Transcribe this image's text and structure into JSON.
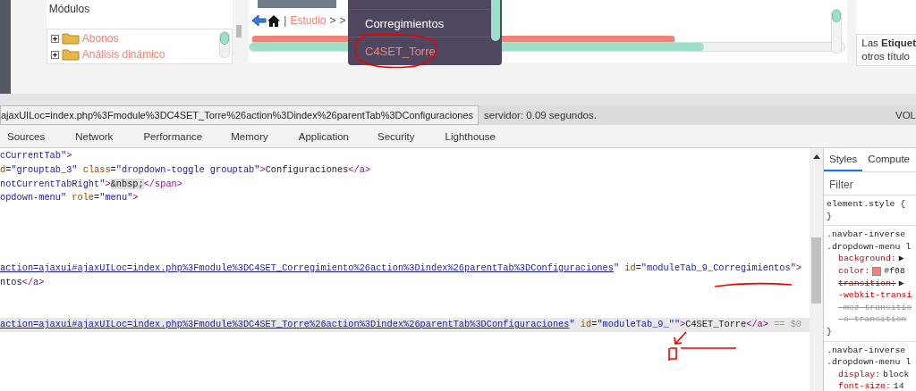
{
  "page": {
    "modules_title": "Módulos",
    "module_tree": [
      {
        "label": "Abonos",
        "expanded": false
      },
      {
        "label": "Análisis dinámico",
        "expanded": false
      }
    ],
    "breadcrumb": {
      "separator": "|",
      "current": "Estudio",
      "arrows": [
        ">",
        ">"
      ]
    },
    "dropdown_menu": [
      {
        "label": "Corregimientos",
        "selected": false
      },
      {
        "label": "C4SET_Torre",
        "selected": true
      }
    ],
    "side_note": [
      "Las **Etiquet**",
      "otros título"
    ]
  },
  "status_bar": {
    "link_url": "ajaxUILoc=index.php%3Fmodule%3DC4SET_Torre%26action%3Dindex%26parentTab%3DConfiguraciones",
    "server_time": "servidor: 0.09 segundos.",
    "right_text": "VOL"
  },
  "devtools": {
    "tabs": [
      "Sources",
      "Network",
      "Performance",
      "Memory",
      "Application",
      "Security",
      "Lighthouse"
    ],
    "elements": [
      {
        "selected": false,
        "segments": [
          {
            "kind": "value",
            "text": "cCurrentTab\""
          },
          {
            "kind": "tag",
            "text": ">"
          }
        ]
      },
      {
        "selected": false,
        "segments": [
          {
            "kind": "attr",
            "text": "d"
          },
          {
            "kind": "plain",
            "text": "="
          },
          {
            "kind": "value",
            "text": "\"grouptab_3\""
          },
          {
            "kind": "attr",
            "text": " class"
          },
          {
            "kind": "plain",
            "text": "="
          },
          {
            "kind": "value",
            "text": "\"dropdown-toggle grouptab\""
          },
          {
            "kind": "tag",
            "text": ">"
          },
          {
            "kind": "plain",
            "text": "Configuraciones"
          },
          {
            "kind": "tag",
            "text": "</a>"
          }
        ]
      },
      {
        "selected": false,
        "segments": [
          {
            "kind": "value",
            "text": "notCurrentTabRight\""
          },
          {
            "kind": "tag",
            "text": ">"
          },
          {
            "kind": "entity",
            "text": "&nbsp;"
          },
          {
            "kind": "tag",
            "text": "</span>"
          }
        ]
      },
      {
        "selected": false,
        "segments": [
          {
            "kind": "value",
            "text": "opdown-menu\""
          },
          {
            "kind": "attr",
            "text": " role"
          },
          {
            "kind": "plain",
            "text": "="
          },
          {
            "kind": "value",
            "text": "\"menu\""
          },
          {
            "kind": "tag",
            "text": ">"
          }
        ]
      },
      {
        "selected": false
      },
      {
        "selected": false
      },
      {
        "selected": false
      },
      {
        "selected": false
      },
      {
        "selected": false,
        "segments": [
          {
            "kind": "link",
            "text": "action=ajaxui#ajaxUILoc=index.php%3Fmodule%3DC4SET_Corregimiento%26action%3Dindex%26parentTab%3DConfiguraciones"
          },
          {
            "kind": "value",
            "text": "\""
          },
          {
            "kind": "attr",
            "text": " id"
          },
          {
            "kind": "plain",
            "text": "="
          },
          {
            "kind": "value",
            "text": "\"moduleTab_9_Corregimientos\""
          },
          {
            "kind": "tag",
            "text": ">"
          }
        ]
      },
      {
        "selected": false,
        "segments": [
          {
            "kind": "plain",
            "text": "ntos"
          },
          {
            "kind": "tag",
            "text": "</a>"
          }
        ]
      },
      {
        "selected": false
      },
      {
        "selected": false
      },
      {
        "selected": true,
        "segments": [
          {
            "kind": "link",
            "text": "action=ajaxui#ajaxUILoc=index.php%3Fmodule%3DC4SET_Torre%26action%3Dindex%26parentTab%3DConfiguraciones"
          },
          {
            "kind": "value",
            "text": "\""
          },
          {
            "kind": "attr",
            "text": " id"
          },
          {
            "kind": "plain",
            "text": "="
          },
          {
            "kind": "value",
            "text": "\"moduleTab_9_\"\""
          },
          {
            "kind": "tag",
            "text": ">"
          },
          {
            "kind": "plain",
            "text": "C4SET_Torre"
          },
          {
            "kind": "tag",
            "text": "</a>"
          },
          {
            "kind": "dim",
            "text": " == $0"
          }
        ]
      }
    ],
    "styles_tabs": [
      {
        "label": "Styles",
        "selected": true
      },
      {
        "label": "Compute",
        "selected": false
      }
    ],
    "filter_placeholder": "Filter",
    "rules": [
      {
        "selector": [
          "element.style {"
        ],
        "close": "}"
      },
      {
        "selector": [
          ".navbar-inverse",
          ".dropdown-menu l"
        ],
        "declarations": [
          {
            "name": "background:",
            "value": "▶",
            "struck": false,
            "inactive": false
          },
          {
            "name": "color:",
            "value": "#f08",
            "swatch": true,
            "struck": false,
            "inactive": false
          },
          {
            "name": "transition:",
            "value": "▶",
            "struck": true,
            "inactive": false
          },
          {
            "name": "-webkit-transi",
            "struck": false,
            "inactive": false
          },
          {
            "name": "-moz-transitio",
            "struck": true,
            "inactive": true
          },
          {
            "name": "-o-transition",
            "struck": true,
            "inactive": true
          }
        ],
        "close": "}"
      },
      {
        "selector": [
          ".navbar-inverse",
          ".dropdown-menu l"
        ],
        "declarations": [
          {
            "name": "display:",
            "value": "block",
            "struck": false,
            "inactive": false
          },
          {
            "name": "font-size:",
            "value": "14",
            "struck": false,
            "inactive": false
          }
        ]
      }
    ]
  }
}
